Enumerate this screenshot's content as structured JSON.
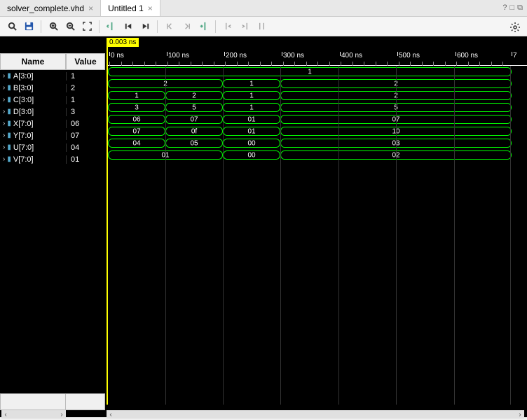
{
  "tabs": [
    {
      "label": "solver_complete.vhd",
      "active": false
    },
    {
      "label": "Untitled 1",
      "active": true
    }
  ],
  "cursor_time": "0.003 ns",
  "time_axis": {
    "unit": "ns",
    "ticks": [
      {
        "pos": 4,
        "label": "0 ns"
      },
      {
        "pos": 86,
        "label": "100 ns"
      },
      {
        "pos": 168,
        "label": "200 ns"
      },
      {
        "pos": 250,
        "label": "300 ns"
      },
      {
        "pos": 333,
        "label": "400 ns"
      },
      {
        "pos": 415,
        "label": "500 ns"
      },
      {
        "pos": 498,
        "label": "600 ns"
      },
      {
        "pos": 578,
        "label": "7"
      }
    ]
  },
  "headers": {
    "name": "Name",
    "value": "Value"
  },
  "signals": [
    {
      "name": "A[3:0]",
      "value": "1",
      "segments": [
        {
          "start": 4,
          "end": 580,
          "val": "1"
        }
      ]
    },
    {
      "name": "B[3:0]",
      "value": "2",
      "segments": [
        {
          "start": 4,
          "end": 168,
          "val": "2"
        },
        {
          "start": 168,
          "end": 250,
          "val": "1"
        },
        {
          "start": 250,
          "end": 580,
          "val": "2"
        }
      ]
    },
    {
      "name": "C[3:0]",
      "value": "1",
      "segments": [
        {
          "start": 4,
          "end": 86,
          "val": "1"
        },
        {
          "start": 86,
          "end": 168,
          "val": "2"
        },
        {
          "start": 168,
          "end": 250,
          "val": "1"
        },
        {
          "start": 250,
          "end": 580,
          "val": "2"
        }
      ]
    },
    {
      "name": "D[3:0]",
      "value": "3",
      "segments": [
        {
          "start": 4,
          "end": 86,
          "val": "3"
        },
        {
          "start": 86,
          "end": 168,
          "val": "5"
        },
        {
          "start": 168,
          "end": 250,
          "val": "1"
        },
        {
          "start": 250,
          "end": 580,
          "val": "5"
        }
      ]
    },
    {
      "name": "X[7:0]",
      "value": "06",
      "segments": [
        {
          "start": 4,
          "end": 86,
          "val": "06"
        },
        {
          "start": 86,
          "end": 168,
          "val": "07"
        },
        {
          "start": 168,
          "end": 250,
          "val": "01"
        },
        {
          "start": 250,
          "end": 580,
          "val": "07"
        }
      ]
    },
    {
      "name": "Y[7:0]",
      "value": "07",
      "segments": [
        {
          "start": 4,
          "end": 86,
          "val": "07"
        },
        {
          "start": 86,
          "end": 168,
          "val": "0f"
        },
        {
          "start": 168,
          "end": 250,
          "val": "01"
        },
        {
          "start": 250,
          "end": 580,
          "val": "10"
        }
      ]
    },
    {
      "name": "U[7:0]",
      "value": "04",
      "segments": [
        {
          "start": 4,
          "end": 86,
          "val": "04"
        },
        {
          "start": 86,
          "end": 168,
          "val": "05"
        },
        {
          "start": 168,
          "end": 250,
          "val": "00"
        },
        {
          "start": 250,
          "end": 580,
          "val": "03"
        }
      ]
    },
    {
      "name": "V[7:0]",
      "value": "01",
      "segments": [
        {
          "start": 4,
          "end": 168,
          "val": "01"
        },
        {
          "start": 168,
          "end": 250,
          "val": "00"
        },
        {
          "start": 250,
          "end": 580,
          "val": "02"
        }
      ]
    }
  ]
}
